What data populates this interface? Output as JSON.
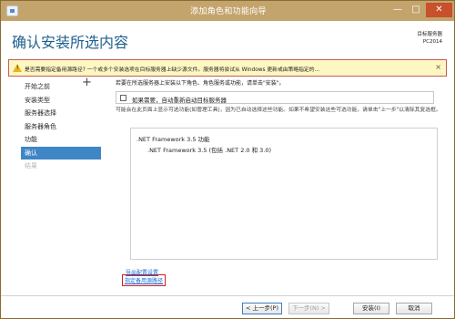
{
  "window": {
    "title": "添加角色和功能向导",
    "minimize": "—",
    "maximize": "□",
    "close": "✕"
  },
  "header": {
    "title": "确认安装所选内容",
    "target_label": "目标服务器",
    "target_value": "PC2014"
  },
  "warning": {
    "text": "是否需要指定备用源路径? 一个或多个安装选项在目标服务器上缺少源文件。服务器将尝试从 Windows 更新或由策略指定的...",
    "close": "×"
  },
  "nav": {
    "items": [
      {
        "label": "开始之前"
      },
      {
        "label": "安装类型"
      },
      {
        "label": "服务器选择"
      },
      {
        "label": "服务器角色"
      },
      {
        "label": "功能"
      },
      {
        "label": "确认"
      },
      {
        "label": "结果"
      }
    ]
  },
  "main": {
    "intro": "若要在所选服务器上安装以下角色、角色服务或功能，请单击\"安装\"。",
    "restart_checkbox": "如果需要，自动重新启动目标服务器",
    "info": "可能会在此页面上显示可选功能(如管理工具)，因为已自动选择这些功能。如果不希望安装这些可选功能，请单击\"上一步\"以清除其复选框。",
    "features": [
      ".NET Framework 3.5 功能",
      ".NET Framework 3.5 (包括 .NET 2.0 和 3.0)"
    ],
    "export_link": "导出配置设置",
    "alt_source_link": "指定备用源路径"
  },
  "buttons": {
    "previous": "< 上一步(P)",
    "next": "下一步(N) >",
    "install": "安装(I)",
    "cancel": "取消"
  },
  "colors": {
    "title_bar": "#c4a46d",
    "heading": "#1f5f8d",
    "active_nav": "#3f86c7",
    "warning_bg": "#fff7c2",
    "link": "#1c6ad1",
    "highlight": "#d21f1f"
  }
}
